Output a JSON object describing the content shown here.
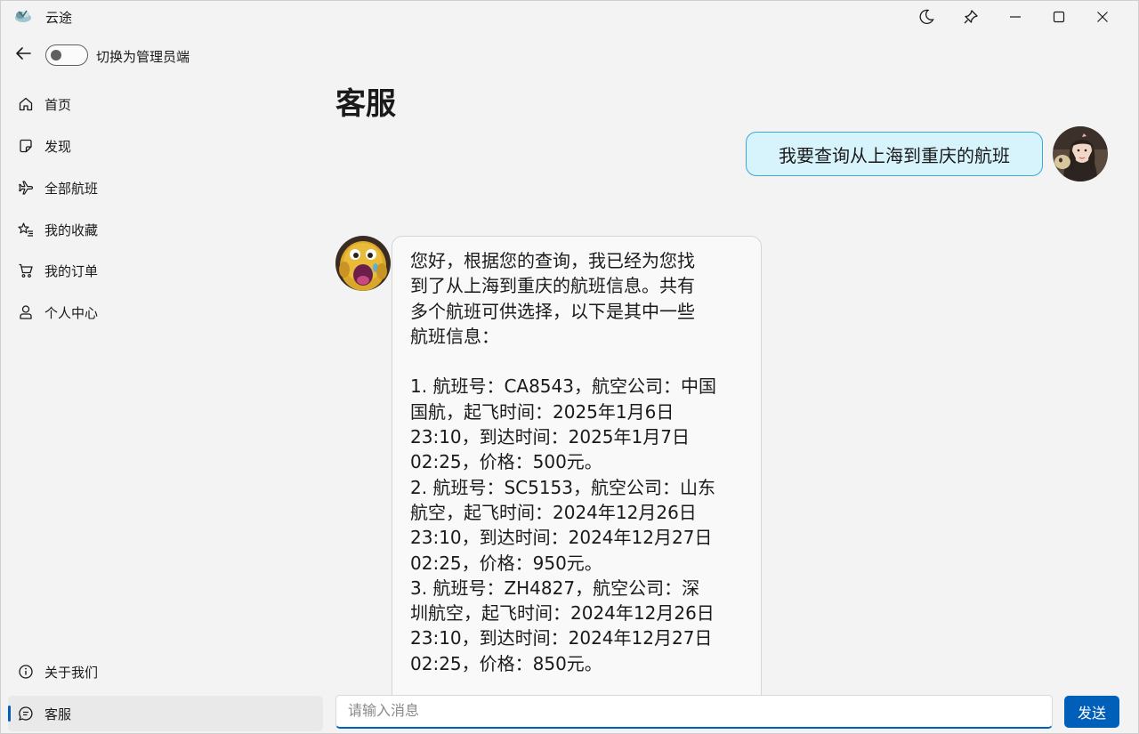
{
  "window": {
    "title": "云途",
    "controls": [
      "theme-moon-icon",
      "pin-icon",
      "minimize-icon",
      "maximize-icon",
      "close-icon"
    ]
  },
  "header": {
    "back_icon": "arrow-left-icon",
    "toggle_label": "切换为管理员端",
    "toggle_on": false
  },
  "sidebar": {
    "items": [
      {
        "label": "首页",
        "icon": "home-icon"
      },
      {
        "label": "发现",
        "icon": "sticky-note-icon"
      },
      {
        "label": "全部航班",
        "icon": "airplane-icon"
      },
      {
        "label": "我的收藏",
        "icon": "star-list-icon"
      },
      {
        "label": "我的订单",
        "icon": "cart-icon"
      },
      {
        "label": "个人中心",
        "icon": "person-icon"
      }
    ],
    "footer_items": [
      {
        "label": "关于我们",
        "icon": "info-icon"
      },
      {
        "label": "客服",
        "icon": "chat-icon",
        "active": true
      }
    ]
  },
  "main": {
    "title": "客服",
    "messages": [
      {
        "role": "user",
        "text": "我要查询从上海到重庆的航班"
      },
      {
        "role": "assistant",
        "lines": [
          "您好，根据您的查询，我已经为您找",
          "到了从上海到重庆的航班信息。共有",
          "多个航班可供选择，以下是其中一些",
          "航班信息：",
          "",
          "1. 航班号：CA8543，航空公司：中国",
          "国航，起飞时间：2025年1月6日",
          "23:10，到达时间：2025年1月7日",
          "02:25，价格：500元。",
          "2. 航班号：SC5153，航空公司：山东",
          "航空，起飞时间：2024年12月26日",
          "23:10，到达时间：2024年12月27日",
          "02:25，价格：950元。",
          "3. 航班号：ZH4827，航空公司：深",
          "圳航空，起飞时间：2024年12月26日",
          "23:10，到达时间：2024年12月27日",
          "02:25，价格：850元。"
        ]
      }
    ]
  },
  "composer": {
    "placeholder": "请输入消息",
    "value": "",
    "send_label": "发送"
  },
  "colors": {
    "accent": "#005fb8",
    "user_bubble_bg": "#d7f3fc",
    "user_bubble_border": "#3aa8d8",
    "window_bg": "#f3f3f3"
  }
}
